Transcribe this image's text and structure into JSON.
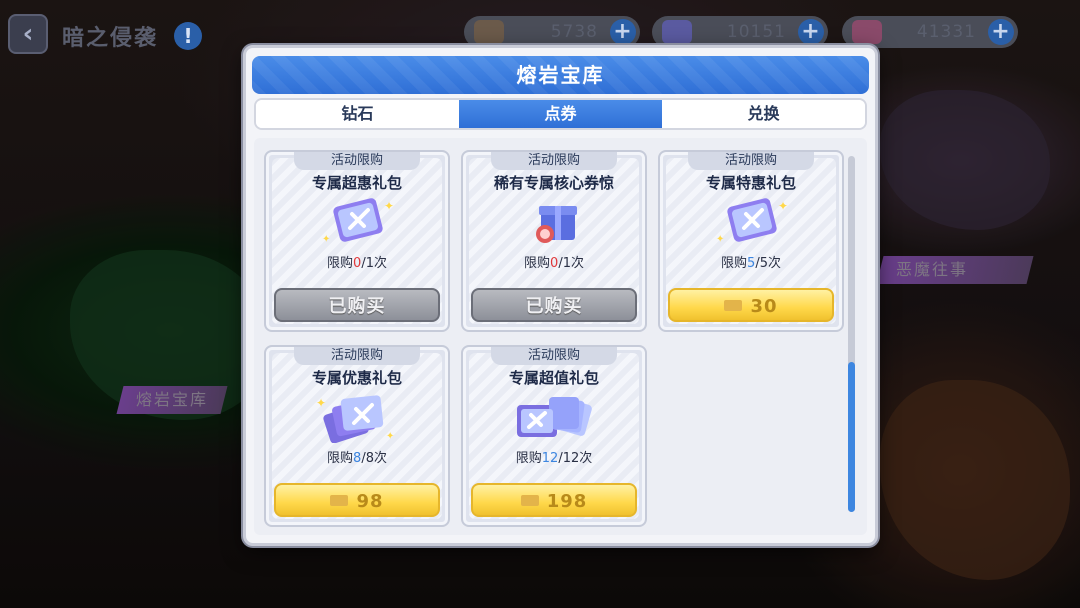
{
  "top_bar": {
    "back_icon": "chevron-left-icon",
    "title": "暗之侵袭",
    "info_icon": "info-icon"
  },
  "currencies": [
    {
      "icon": "coin-sack-icon",
      "value": "5738"
    },
    {
      "icon": "ticket-icon",
      "value": "10151"
    },
    {
      "icon": "crystal-icon",
      "value": "41331"
    }
  ],
  "side_labels": {
    "left": "熔岩宝库",
    "right": "恶魔往事"
  },
  "modal": {
    "title": "熔岩宝库",
    "tabs": [
      {
        "label": "钻石",
        "active": false
      },
      {
        "label": "点券",
        "active": true
      },
      {
        "label": "兑换",
        "active": false
      }
    ]
  },
  "items": [
    {
      "tag": "活动限购",
      "name": "专属超惠礼包",
      "icon": "ticket-card-icon",
      "limit_prefix": "限购",
      "bought": "0",
      "limit_suffix": "/1次",
      "status_color": "red",
      "button": "已购买",
      "price": ""
    },
    {
      "tag": "活动限购",
      "name": "稀有专属核心券惊",
      "icon": "gift-box-icon",
      "limit_prefix": "限购",
      "bought": "0",
      "limit_suffix": "/1次",
      "status_color": "red",
      "button": "已购买",
      "price": ""
    },
    {
      "tag": "活动限购",
      "name": "专属特惠礼包",
      "icon": "ticket-card-icon",
      "limit_prefix": "限购",
      "bought": "5",
      "limit_suffix": "/5次",
      "status_color": "blue",
      "button": "",
      "price": "30"
    },
    {
      "tag": "活动限购",
      "name": "专属优惠礼包",
      "icon": "ticket-stack-icon",
      "limit_prefix": "限购",
      "bought": "8",
      "limit_suffix": "/8次",
      "status_color": "blue",
      "button": "",
      "price": "98"
    },
    {
      "tag": "活动限购",
      "name": "专属超值礼包",
      "icon": "ticket-fan-icon",
      "limit_prefix": "限购",
      "bought": "12",
      "limit_suffix": "/12次",
      "status_color": "blue",
      "button": "",
      "price": "198"
    }
  ],
  "colors": {
    "accent_blue": "#2f6fd6",
    "buy_yellow": "#ffd84a",
    "limit_red": "#e0373a",
    "limit_blue": "#3d86e0"
  },
  "scroll_fraction": 0.42
}
